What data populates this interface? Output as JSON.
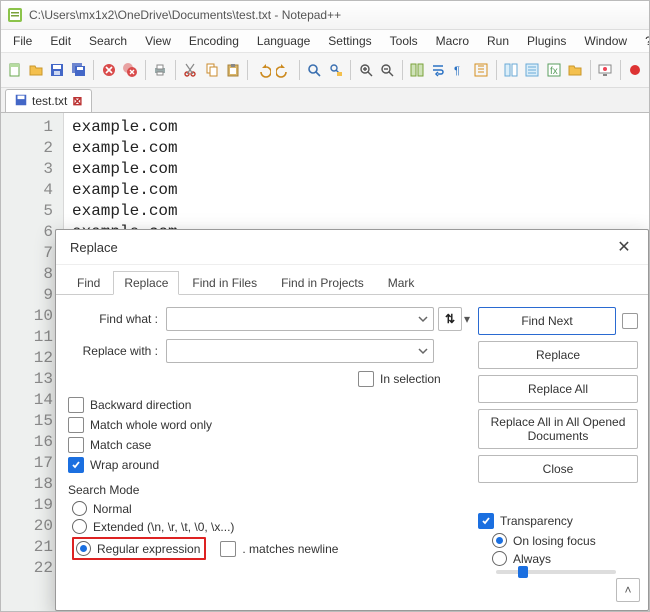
{
  "title": "C:\\Users\\mx1x2\\OneDrive\\Documents\\test.txt - Notepad++",
  "menu": {
    "file": "File",
    "edit": "Edit",
    "search": "Search",
    "view": "View",
    "encoding": "Encoding",
    "language": "Language",
    "settings": "Settings",
    "tools": "Tools",
    "macro": "Macro",
    "run": "Run",
    "plugins": "Plugins",
    "window": "Window",
    "help": "?"
  },
  "filetab": {
    "name": "test.txt"
  },
  "gutter": [
    "1",
    "2",
    "3",
    "4",
    "5",
    "6",
    "7",
    "8",
    "9",
    "10",
    "11",
    "12",
    "13",
    "14",
    "15",
    "16",
    "17",
    "18",
    "19",
    "20",
    "21",
    "22"
  ],
  "lines": [
    "example.com",
    "example.com",
    "example.com",
    "example.com",
    "example.com",
    "example.com"
  ],
  "dialog": {
    "title": "Replace",
    "tabs": {
      "find": "Find",
      "replace": "Replace",
      "findfiles": "Find in Files",
      "findproj": "Find in Projects",
      "mark": "Mark"
    },
    "labels": {
      "find_what": "Find what :",
      "replace_with": "Replace with :",
      "in_selection": "In selection",
      "search_mode": "Search Mode",
      "transparency": "Transparency"
    },
    "checks": {
      "backward": "Backward direction",
      "whole_word": "Match whole word only",
      "match_case": "Match case",
      "wrap": "Wrap around"
    },
    "radios": {
      "normal": "Normal",
      "extended": "Extended (\\n, \\r, \\t, \\0, \\x...)",
      "regex": "Regular expression",
      "matches_newline": ". matches newline",
      "on_losing": "On losing focus",
      "always": "Always"
    },
    "buttons": {
      "find_next": "Find Next",
      "replace": "Replace",
      "replace_all": "Replace All",
      "replace_all_opened": "Replace All in All Opened Documents",
      "close": "Close"
    },
    "swap": "⇅"
  }
}
